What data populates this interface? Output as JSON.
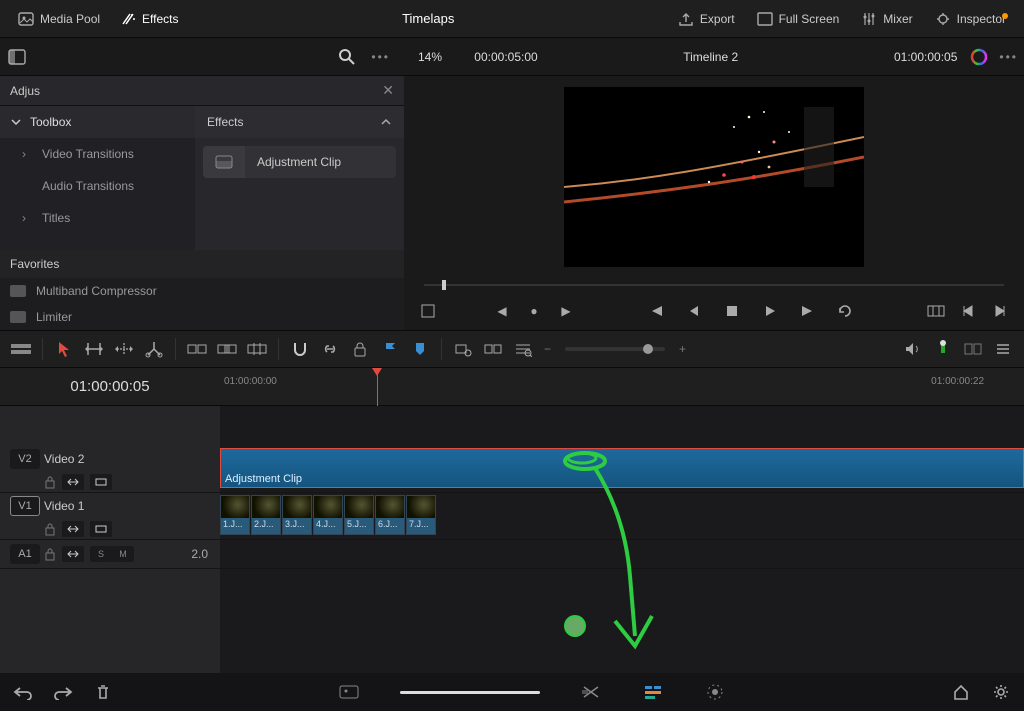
{
  "topbar": {
    "mediapool": "Media Pool",
    "effects": "Effects",
    "title": "Timelaps",
    "export": "Export",
    "fullscreen": "Full Screen",
    "mixer": "Mixer",
    "inspector": "Inspector"
  },
  "secondbar": {
    "zoom": "14%",
    "timecode_src": "00:00:05:00",
    "timeline_name": "Timeline 2",
    "timecode_play": "01:00:00:05"
  },
  "filter": {
    "value": "Adjus"
  },
  "toolbox": {
    "header": "Toolbox",
    "items": [
      "Video Transitions",
      "Audio Transitions",
      "Titles"
    ]
  },
  "effects_panel": {
    "header": "Effects",
    "item": "Adjustment Clip"
  },
  "favorites": {
    "header": "Favorites",
    "items": [
      "Multiband Compressor",
      "Limiter"
    ]
  },
  "timeline": {
    "counter": "01:00:00:05",
    "ruler_start": "01:00:00:00",
    "ruler_end": "01:00:00:22",
    "tracks": {
      "v2": {
        "badge": "V2",
        "name": "Video 2",
        "clip": "Adjustment Clip"
      },
      "v1": {
        "badge": "V1",
        "name": "Video 1",
        "clips": [
          "1.J...",
          "2.J...",
          "3.J...",
          "4.J...",
          "5.J...",
          "6.J...",
          "7.J..."
        ]
      },
      "a1": {
        "badge": "A1",
        "db": "2.0",
        "solo": "S",
        "mute": "M"
      }
    }
  }
}
